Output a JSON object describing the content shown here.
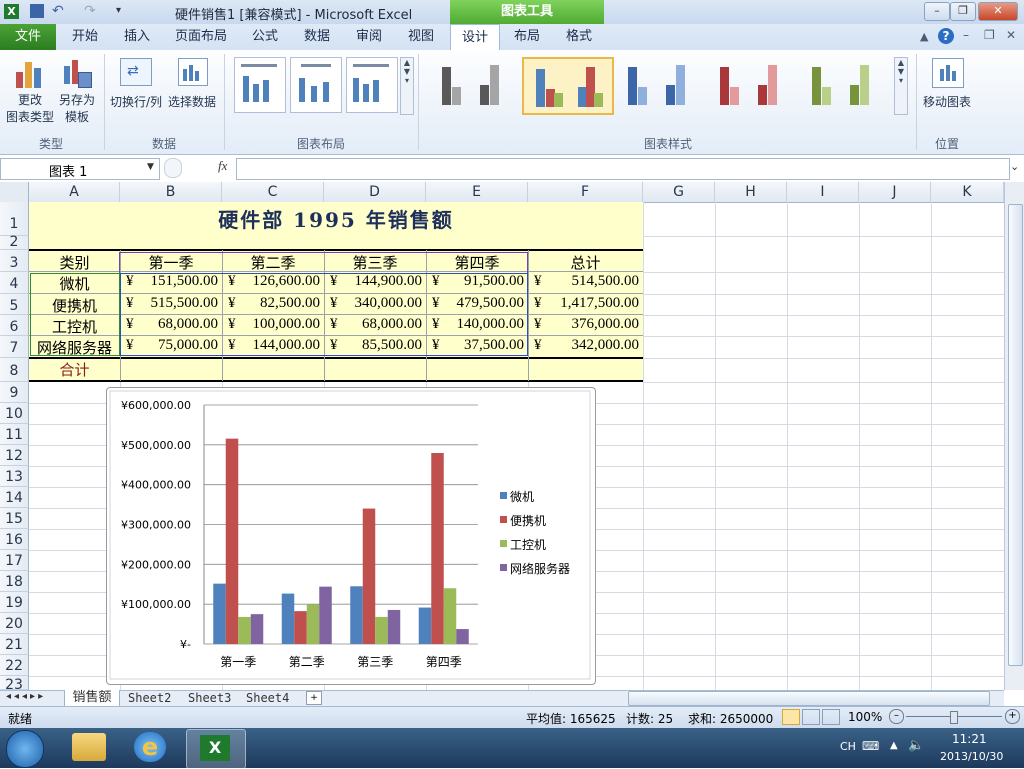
{
  "window": {
    "title": "硬件销售1  [兼容模式] - Microsoft Excel",
    "chart_tools": "图表工具"
  },
  "ribbon_tabs": [
    "文件",
    "开始",
    "插入",
    "页面布局",
    "公式",
    "数据",
    "审阅",
    "视图",
    "设计",
    "布局",
    "格式"
  ],
  "ribbon": {
    "change_type": [
      "更改",
      "图表类型"
    ],
    "save_template": [
      "另存为",
      "模板"
    ],
    "switch_row_col": "切换行/列",
    "select_data": "选择数据",
    "move_chart": "移动图表",
    "groups": {
      "type": "类型",
      "data": "数据",
      "layout": "图表布局",
      "styles": "图表样式",
      "location": "位置"
    }
  },
  "name_box": "图表 1",
  "fx": "fx",
  "columns": [
    "A",
    "B",
    "C",
    "D",
    "E",
    "F",
    "G",
    "H",
    "I",
    "J",
    "K"
  ],
  "rows": [
    "1",
    "2",
    "3",
    "4",
    "5",
    "6",
    "7",
    "8",
    "9",
    "10",
    "11",
    "12",
    "13",
    "14",
    "15",
    "16",
    "17",
    "18",
    "19",
    "20",
    "21",
    "22",
    "23"
  ],
  "sheet": {
    "title": "硬件部 1995 年销售额",
    "headers": [
      "类别",
      "第一季",
      "第二季",
      "第三季",
      "第四季",
      "总计"
    ],
    "currency": "¥",
    "data_rows": [
      [
        "微机",
        "151,500.00",
        "126,600.00",
        "144,900.00",
        "91,500.00",
        "514,500.00"
      ],
      [
        "便携机",
        "515,500.00",
        "82,500.00",
        "340,000.00",
        "479,500.00",
        "1,417,500.00"
      ],
      [
        "工控机",
        "68,000.00",
        "100,000.00",
        "68,000.00",
        "140,000.00",
        "376,000.00"
      ],
      [
        "网络服务器",
        "75,000.00",
        "144,000.00",
        "85,500.00",
        "37,500.00",
        "342,000.00"
      ]
    ],
    "total_label": "合计"
  },
  "sheet_tabs": [
    "销售额",
    "Sheet2",
    "Sheet3",
    "Sheet4"
  ],
  "status": {
    "ready": "就绪",
    "average": "平均值: 165625",
    "count": "计数: 25",
    "sum": "求和: 2650000",
    "zoom": "100%"
  },
  "taskbar": {
    "lang": "CH",
    "time": "11:21",
    "date": "2013/10/30"
  },
  "colors": {
    "series": [
      "#4f81bd",
      "#c0504d",
      "#9bbb59",
      "#8064a2"
    ],
    "table_fill": "#ffffcc",
    "ribbon_green": "#3c9a2c"
  },
  "chart_data": {
    "type": "bar",
    "categories": [
      "第一季",
      "第二季",
      "第三季",
      "第四季"
    ],
    "series": [
      {
        "name": "微机",
        "values": [
          151500,
          126600,
          144900,
          91500
        ]
      },
      {
        "name": "便携机",
        "values": [
          515500,
          82500,
          340000,
          479500
        ]
      },
      {
        "name": "工控机",
        "values": [
          68000,
          100000,
          68000,
          140000
        ]
      },
      {
        "name": "网络服务器",
        "values": [
          75000,
          144000,
          85500,
          37500
        ]
      }
    ],
    "ylim": [
      0,
      600000
    ],
    "yticks": [
      "¥-",
      "¥100,000.00",
      "¥200,000.00",
      "¥300,000.00",
      "¥400,000.00",
      "¥500,000.00",
      "¥600,000.00"
    ],
    "grid": true,
    "legend": "right"
  }
}
